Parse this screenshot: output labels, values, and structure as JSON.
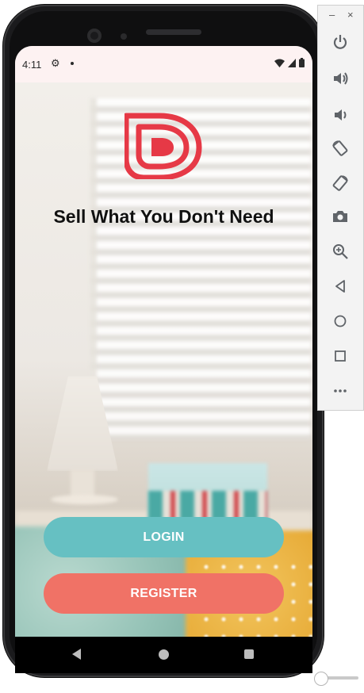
{
  "status_bar": {
    "time": "4:11"
  },
  "app": {
    "tagline": "Sell What You Don't Need",
    "login_label": "LOGIN",
    "register_label": "REGISTER",
    "logo_color": "#e63946",
    "login_color": "#66c0c2",
    "register_color": "#f07266"
  },
  "emulator": {
    "minimize_label": "–",
    "close_label": "×",
    "controls": [
      "power-icon",
      "volume-up-icon",
      "volume-down-icon",
      "rotate-left-icon",
      "rotate-right-icon",
      "camera-icon",
      "zoom-icon",
      "back-icon",
      "home-icon",
      "overview-icon",
      "more-icon"
    ]
  }
}
